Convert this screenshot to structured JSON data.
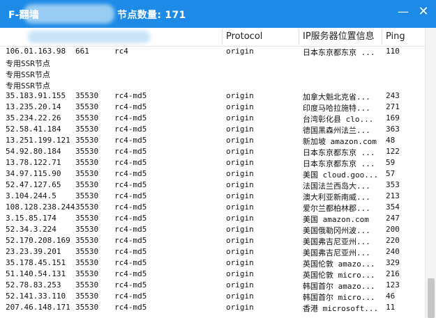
{
  "window": {
    "title_prefix": "F-翻墙",
    "title_suffix": "节点数量: 171",
    "minimize_glyph": "—",
    "close_glyph": "✕"
  },
  "columns": {
    "protocol": "Protocol",
    "location": "IP服务器位置信息",
    "ping": "Ping"
  },
  "rows": [
    {
      "ip": "106.01.163.98",
      "port": "661",
      "method": "rc4",
      "protocol": "origin",
      "location": "日本东京都东京 ...",
      "ping": "110"
    },
    {
      "ssr": "专用SSR节点"
    },
    {
      "ssr": "专用SSR节点"
    },
    {
      "ssr": "专用SSR节点"
    },
    {
      "ip": "35.183.91.155",
      "port": "35530",
      "method": "rc4-md5",
      "protocol": "origin",
      "location": "加拿大魁北克省...",
      "ping": "243"
    },
    {
      "ip": "13.235.20.14",
      "port": "35530",
      "method": "rc4-md5",
      "protocol": "origin",
      "location": "印度马哈拉施特...",
      "ping": "271"
    },
    {
      "ip": "35.234.22.26",
      "port": "35530",
      "method": "rc4-md5",
      "protocol": "origin",
      "location": "台湾彰化县  clo...",
      "ping": "169"
    },
    {
      "ip": "52.58.41.184",
      "port": "35530",
      "method": "rc4-md5",
      "protocol": "origin",
      "location": "德国黑森州法兰...",
      "ping": "363"
    },
    {
      "ip": "13.251.199.121",
      "port": "35530",
      "method": "rc4-md5",
      "protocol": "origin",
      "location": "新加坡  amazon.com",
      "ping": "48"
    },
    {
      "ip": "54.92.80.184",
      "port": "35530",
      "method": "rc4-md5",
      "protocol": "origin",
      "location": "日本东京都东京 ...",
      "ping": "122"
    },
    {
      "ip": "13.78.122.71",
      "port": "35530",
      "method": "rc4-md5",
      "protocol": "origin",
      "location": "日本东京都东京 ...",
      "ping": "59"
    },
    {
      "ip": "34.97.115.90",
      "port": "35530",
      "method": "rc4-md5",
      "protocol": "origin",
      "location": "美国  cloud.goo...",
      "ping": "57"
    },
    {
      "ip": "52.47.127.65",
      "port": "35530",
      "method": "rc4-md5",
      "protocol": "origin",
      "location": "法国法兰西岛大...",
      "ping": "353"
    },
    {
      "ip": "3.104.244.5",
      "port": "35530",
      "method": "rc4-md5",
      "protocol": "origin",
      "location": "澳大利亚新南威...",
      "ping": "213"
    },
    {
      "ip": "108.128.238.244",
      "port": "35530",
      "method": "rc4-md5",
      "protocol": "origin",
      "location": "爱尔兰都柏林郡...",
      "ping": "354"
    },
    {
      "ip": "3.15.85.174",
      "port": "35530",
      "method": "rc4-md5",
      "protocol": "origin",
      "location": "美国  amazon.com",
      "ping": "247"
    },
    {
      "ip": "52.34.3.224",
      "port": "35530",
      "method": "rc4-md5",
      "protocol": "origin",
      "location": "美国俄勒冈州波...",
      "ping": "200"
    },
    {
      "ip": "52.170.208.169",
      "port": "35530",
      "method": "rc4-md5",
      "protocol": "origin",
      "location": "美国弗吉尼亚州...",
      "ping": "220"
    },
    {
      "ip": "23.23.39.201",
      "port": "35530",
      "method": "rc4-md5",
      "protocol": "origin",
      "location": "美国弗吉尼亚州...",
      "ping": "240"
    },
    {
      "ip": "35.178.45.151",
      "port": "35530",
      "method": "rc4-md5",
      "protocol": "origin",
      "location": "英国伦敦  amazo...",
      "ping": "329"
    },
    {
      "ip": "51.140.54.131",
      "port": "35530",
      "method": "rc4-md5",
      "protocol": "origin",
      "location": "英国伦敦  micro...",
      "ping": "216"
    },
    {
      "ip": "52.78.83.253",
      "port": "35530",
      "method": "rc4-md5",
      "protocol": "origin",
      "location": "韩国首尔  amazo...",
      "ping": "123"
    },
    {
      "ip": "52.141.33.110",
      "port": "35530",
      "method": "rc4-md5",
      "protocol": "origin",
      "location": "韩国首尔  micro...",
      "ping": "46"
    },
    {
      "ip": "207.46.148.171",
      "port": "35530",
      "method": "rc4-md5",
      "protocol": "origin",
      "location": "香港  microsoft...",
      "ping": "11"
    }
  ]
}
